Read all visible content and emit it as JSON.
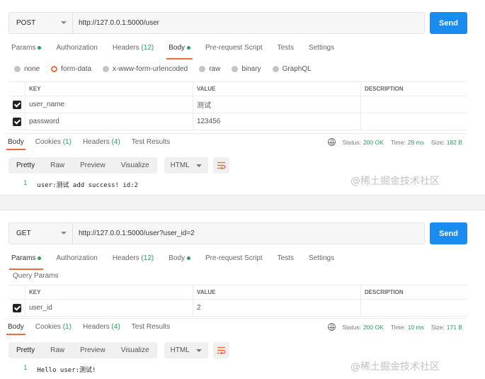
{
  "panels": [
    {
      "method": "POST",
      "url": "http://127.0.0.1:5000/user",
      "send_label": "Send",
      "tabs": [
        "Params",
        "Authorization",
        "Headers",
        "Body",
        "Pre-request Script",
        "Tests",
        "Settings"
      ],
      "headers_count": "(12)",
      "body_types": [
        "none",
        "form-data",
        "x-www-form-urlencoded",
        "raw",
        "binary",
        "GraphQL"
      ],
      "table_headers": [
        "KEY",
        "VALUE",
        "DESCRIPTION"
      ],
      "rows": [
        {
          "key": "user_name",
          "value": "测试"
        },
        {
          "key": "password",
          "value": "123456"
        }
      ],
      "response": {
        "tabs": [
          "Body",
          "Cookies",
          "Headers",
          "Test Results"
        ],
        "cookies_count": "(1)",
        "headers_count": "(4)",
        "status_label": "Status:",
        "status_value": "200 OK",
        "time_label": "Time:",
        "time_value": "29 ms",
        "size_label": "Size:",
        "size_value": "182 B",
        "formats": [
          "Pretty",
          "Raw",
          "Preview",
          "Visualize"
        ],
        "lang": "HTML",
        "line_no": "1",
        "line_text": "user:测试 add success! id:2"
      }
    },
    {
      "method": "GET",
      "url": "http://127.0.0.1:5000/user?user_id=2",
      "send_label": "Send",
      "tabs": [
        "Params",
        "Authorization",
        "Headers",
        "Body",
        "Pre-request Script",
        "Tests",
        "Settings"
      ],
      "headers_count": "(12)",
      "query_params_label": "Query Params",
      "table_headers": [
        "KEY",
        "VALUE",
        "DESCRIPTION"
      ],
      "rows": [
        {
          "key": "user_id",
          "value": "2"
        }
      ],
      "response": {
        "tabs": [
          "Body",
          "Cookies",
          "Headers",
          "Test Results"
        ],
        "cookies_count": "(1)",
        "headers_count": "(4)",
        "status_label": "Status:",
        "status_value": "200 OK",
        "time_label": "Time:",
        "time_value": "10 ms",
        "size_label": "Size:",
        "size_value": "171 B",
        "formats": [
          "Pretty",
          "Raw",
          "Preview",
          "Visualize"
        ],
        "lang": "HTML",
        "line_no": "1",
        "line_text": "Hello user:测试!"
      }
    }
  ],
  "watermark": "@稀土掘金技术社区",
  "colors": {
    "accent": "#f26b3a",
    "send": "#1a8cf0",
    "success": "#26a35b"
  }
}
